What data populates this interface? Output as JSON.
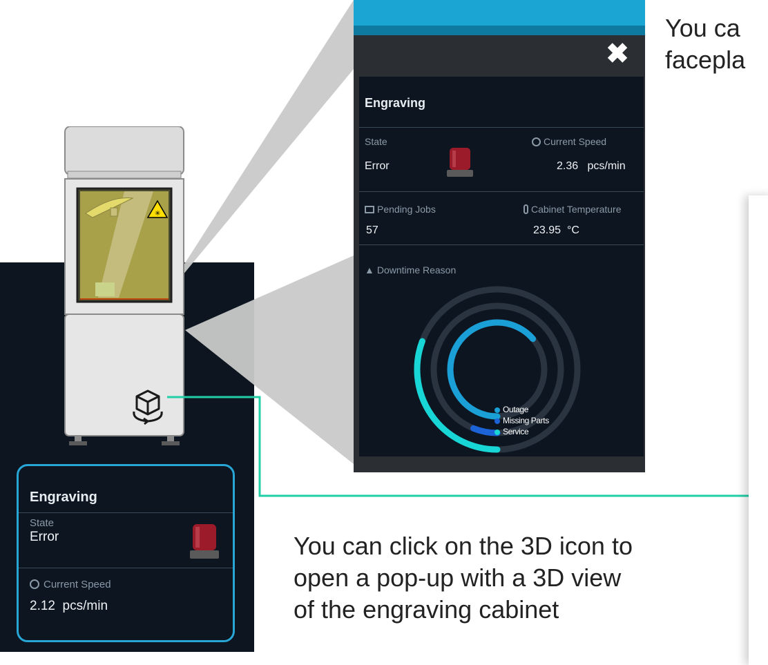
{
  "colors": {
    "panel_bg": "#0c1520",
    "accent_blue": "#28a7d6",
    "connector_green": "#21cfa6",
    "alarm_red": "#9c1b2b"
  },
  "small_card": {
    "title": "Engraving",
    "state_label": "State",
    "state_value": "Error",
    "speed_label": "Current Speed",
    "speed_value": "2.12",
    "speed_unit": "pcs/min"
  },
  "popup": {
    "close_icon": "close-x",
    "title": "Engraving",
    "state_label": "State",
    "state_value": "Error",
    "speed_label": "Current Speed",
    "speed_value": "2.36",
    "speed_unit": "pcs/min",
    "pending_label": "Pending Jobs",
    "pending_value": "57",
    "temp_label": "Cabinet Temperature",
    "temp_value": "23.95",
    "temp_unit": "°C",
    "downtime_label": "Downtime Reason",
    "legend": [
      {
        "name": "Outage",
        "color": "#1a9fd6"
      },
      {
        "name": "Missing Parts",
        "color": "#1b63d6"
      },
      {
        "name": "Service",
        "color": "#18d6d6"
      }
    ]
  },
  "annotations": {
    "top_right": "You ca\nfacepla",
    "bottom": "You can click on the 3D icon to\nopen a pop-up with a 3D view\nof the engraving cabinet"
  }
}
